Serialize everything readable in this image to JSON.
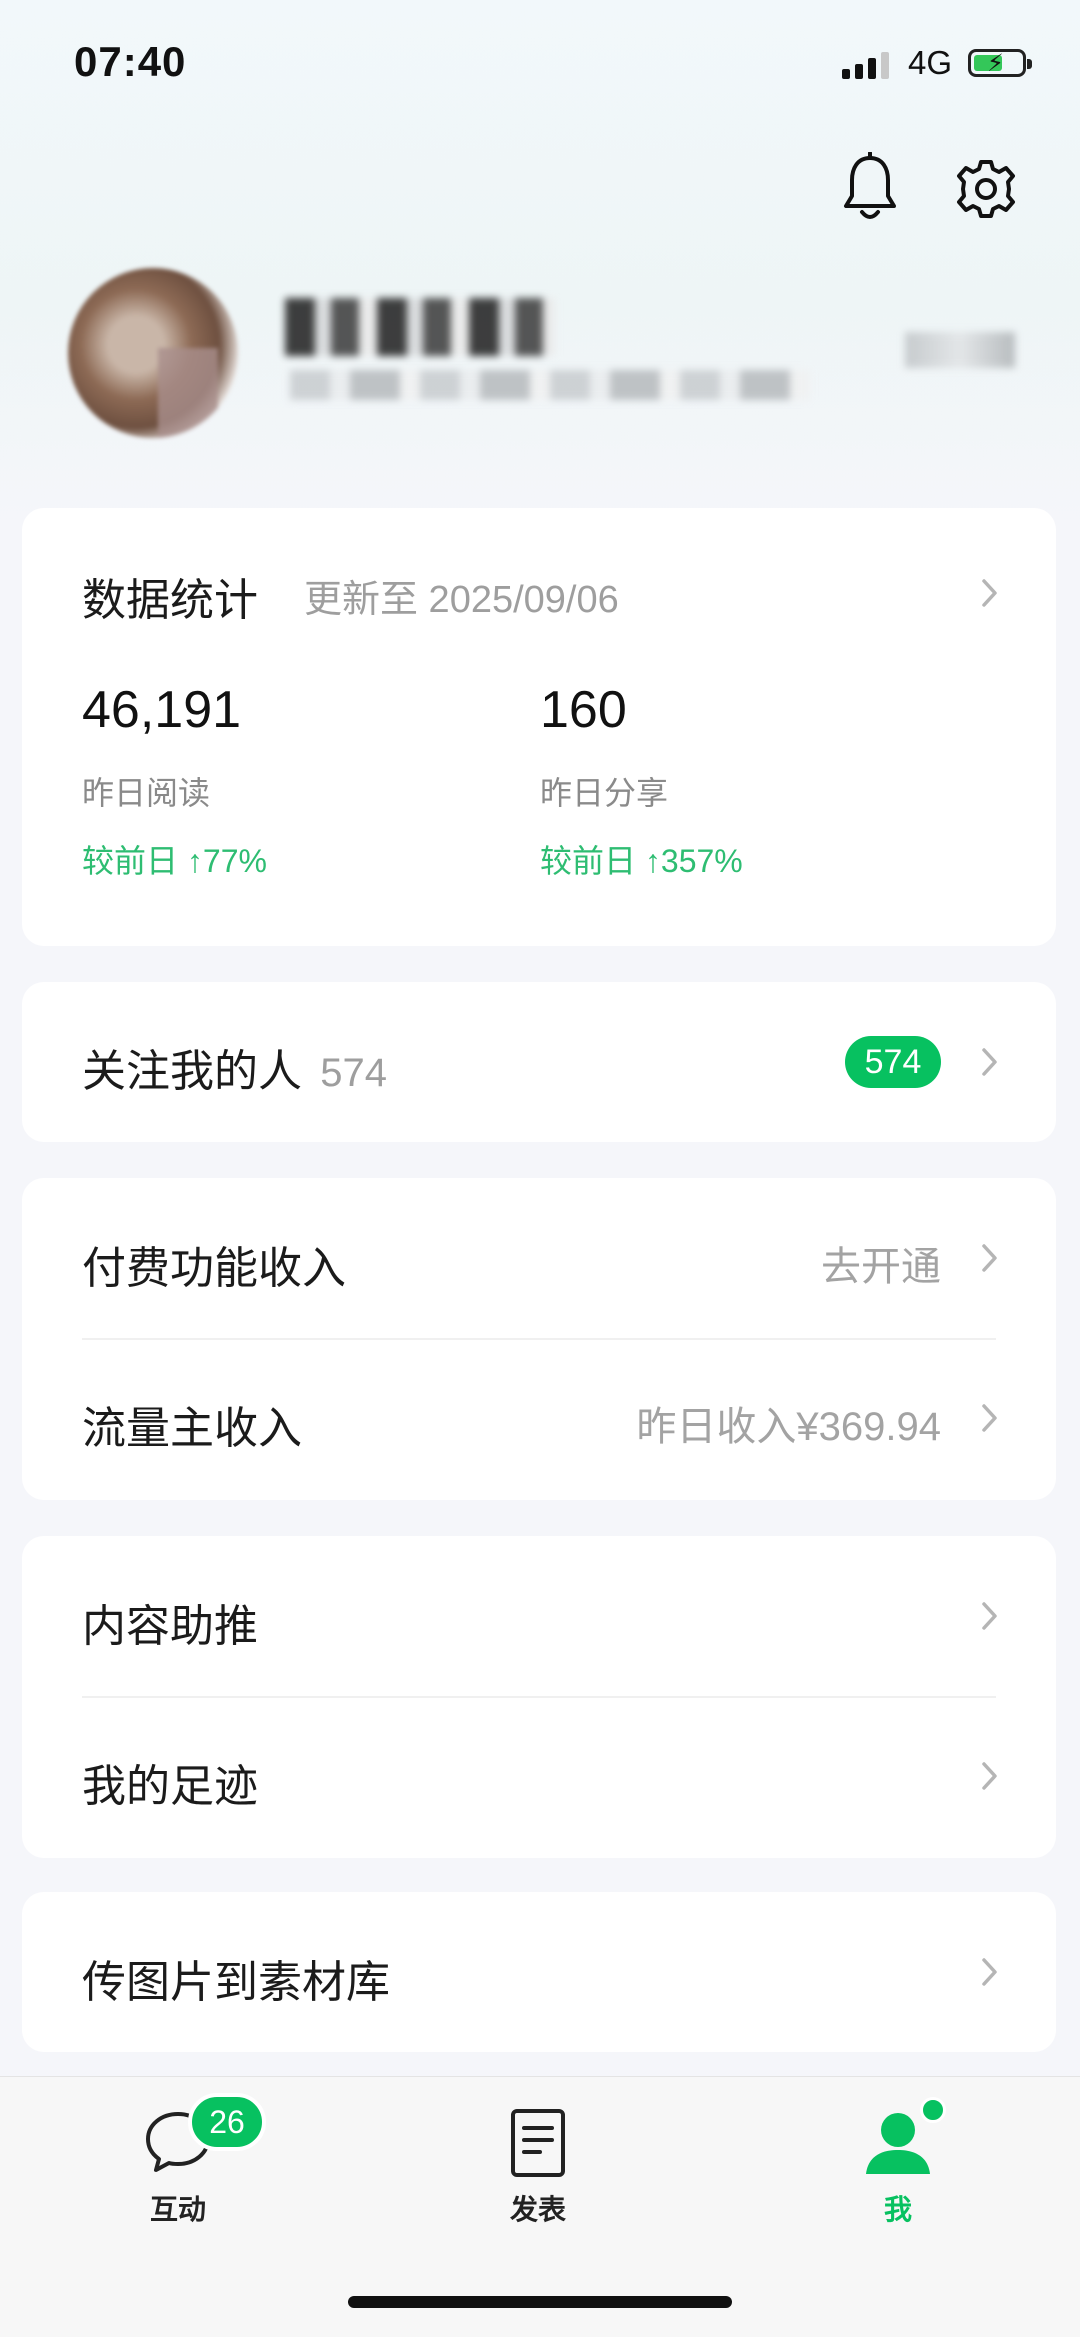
{
  "status_bar": {
    "time": "07:40",
    "network": "4G"
  },
  "stats": {
    "title": "数据统计",
    "updated": "更新至 2025/09/06",
    "items": [
      {
        "value": "46,191",
        "label": "昨日阅读",
        "change": "较前日 ↑77%"
      },
      {
        "value": "160",
        "label": "昨日分享",
        "change": "较前日 ↑357%"
      }
    ]
  },
  "followers": {
    "label": "关注我的人",
    "count": "574",
    "badge": "574"
  },
  "income": {
    "paid_label": "付费功能收入",
    "paid_action": "去开通",
    "traffic_label": "流量主收入",
    "traffic_value": "昨日收入¥369.94"
  },
  "tools": {
    "promote": "内容助推",
    "footprint": "我的足迹"
  },
  "upload": {
    "label": "传图片到素材库"
  },
  "tabbar": {
    "interact": "互动",
    "interact_badge": "26",
    "publish": "发表",
    "me": "我"
  },
  "colors": {
    "accent": "#07c160",
    "up": "#2ebd72"
  }
}
